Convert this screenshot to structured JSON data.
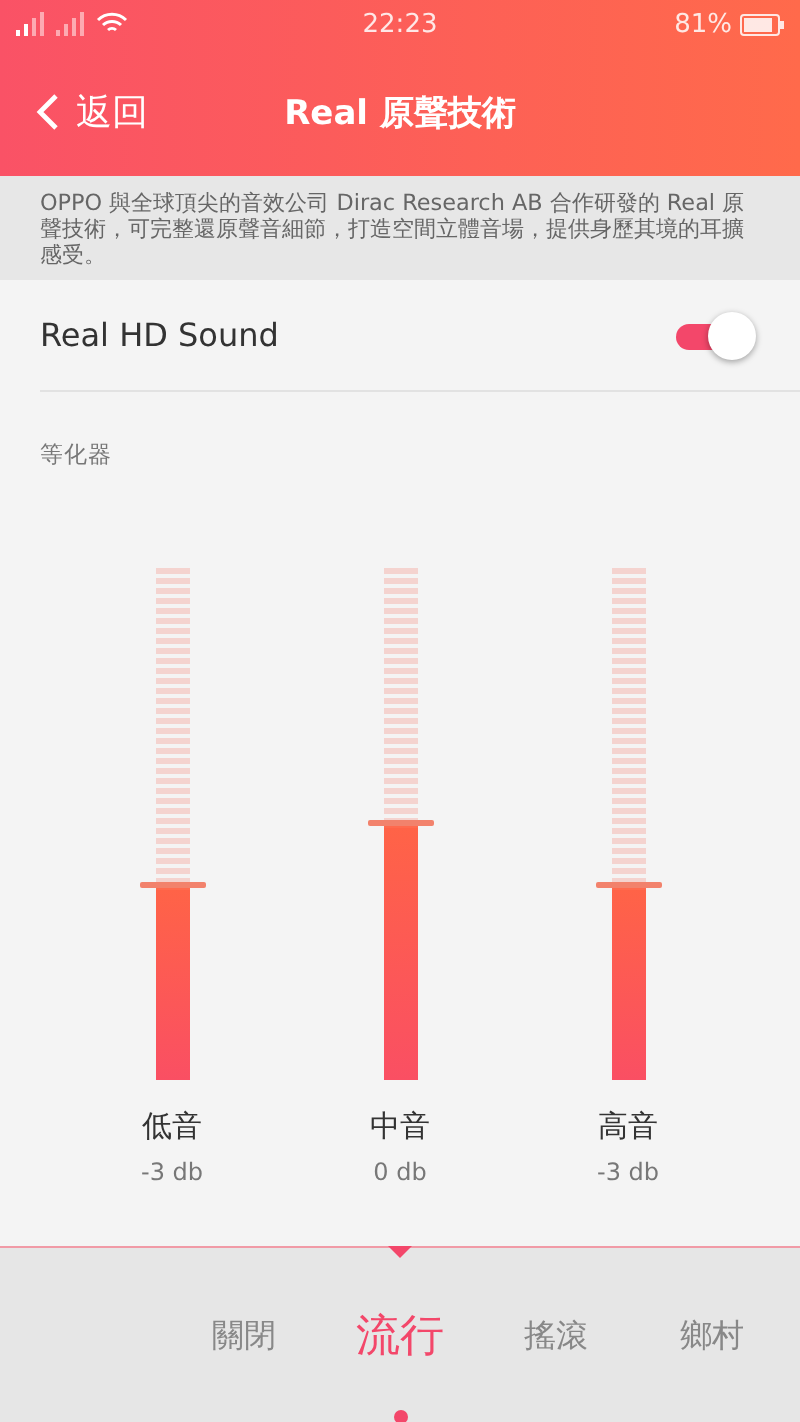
{
  "status_bar": {
    "time": "22:23",
    "battery": "81%"
  },
  "header": {
    "back": "返回",
    "title": "Real 原聲技術"
  },
  "description": "OPPO 與全球頂尖的音效公司 Dirac Research AB 合作研發的 Real 原聲技術，可完整還原聲音細節，打造空間立體音場，提供身歷其境的耳擴感受。",
  "setting": {
    "label": "Real HD Sound",
    "on": true
  },
  "equalizer": {
    "title": "等化器",
    "bands": [
      {
        "name": "低音",
        "value": "-3 db",
        "level": 0.38
      },
      {
        "name": "中音",
        "value": "0 db",
        "level": 0.5
      },
      {
        "name": "高音",
        "value": "-3 db",
        "level": 0.38
      }
    ]
  },
  "presets": [
    {
      "label": "關閉",
      "selected": false
    },
    {
      "label": "流行",
      "selected": true
    },
    {
      "label": "搖滾",
      "selected": false
    },
    {
      "label": "鄉村",
      "selected": false
    }
  ]
}
